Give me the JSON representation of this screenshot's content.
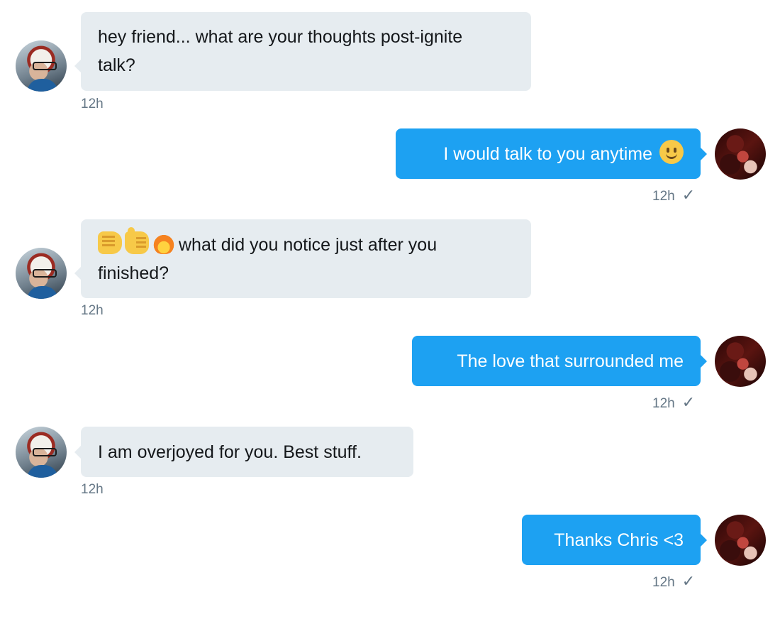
{
  "conversation": {
    "messages": [
      {
        "direction": "incoming",
        "text_line1": "hey friend... what are your thoughts post-ignite",
        "text_line2": "talk?",
        "time": "12h"
      },
      {
        "direction": "outgoing",
        "text": "I would talk to you anytime",
        "emoji": "slightly-smiling-face",
        "time": "12h",
        "status": "✓"
      },
      {
        "direction": "incoming",
        "emojis": [
          "oncoming-fist",
          "thumbs-up",
          "fire"
        ],
        "text_line1": "what did you notice just after you",
        "text_line2": "finished?",
        "time": "12h"
      },
      {
        "direction": "outgoing",
        "text": "The love that surrounded me",
        "time": "12h",
        "status": "✓"
      },
      {
        "direction": "incoming",
        "text": "I am overjoyed for you. Best stuff.",
        "time": "12h"
      },
      {
        "direction": "outgoing",
        "text": "Thanks Chris <3",
        "time": "12h",
        "status": "✓"
      }
    ]
  },
  "colors": {
    "incoming_bubble": "#e6ecf0",
    "outgoing_bubble": "#1da1f2",
    "timestamp": "#657786",
    "incoming_text": "#14171a",
    "outgoing_text": "#ffffff"
  },
  "icons": {
    "incoming_avatar": "user-avatar-chris",
    "outgoing_avatar": "user-avatar-self",
    "read_status": "checkmark-icon"
  }
}
